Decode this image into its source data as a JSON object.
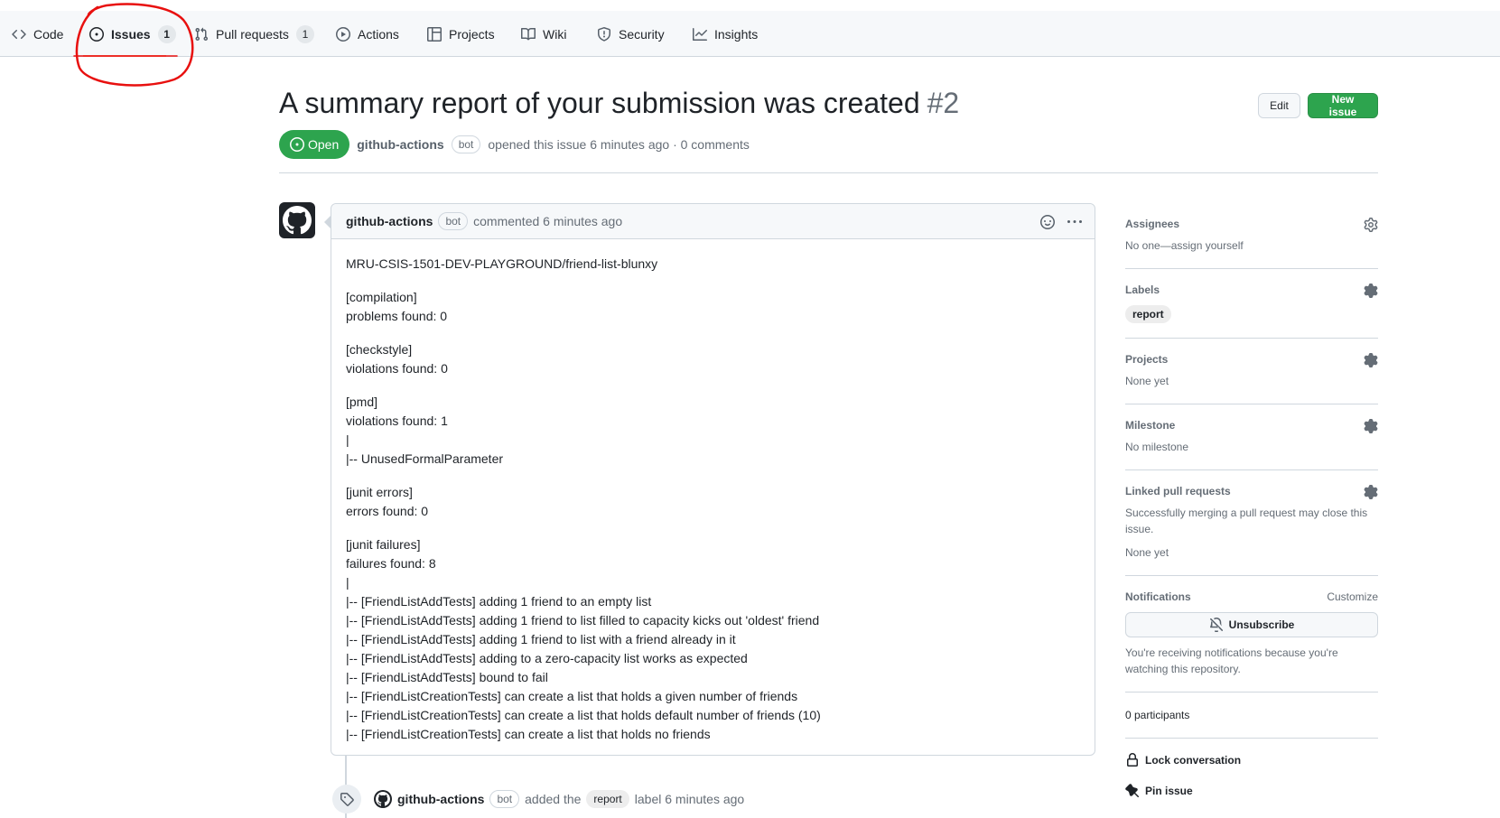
{
  "nav": {
    "items": [
      {
        "label": "Code",
        "icon": "code-icon"
      },
      {
        "label": "Issues",
        "icon": "issue-opened-icon",
        "counter": "1",
        "selected": true
      },
      {
        "label": "Pull requests",
        "icon": "git-pull-request-icon",
        "counter": "1"
      },
      {
        "label": "Actions",
        "icon": "play-icon"
      },
      {
        "label": "Projects",
        "icon": "table-icon"
      },
      {
        "label": "Wiki",
        "icon": "book-icon"
      },
      {
        "label": "Security",
        "icon": "shield-icon"
      },
      {
        "label": "Insights",
        "icon": "graph-icon"
      }
    ]
  },
  "annotation": {
    "color": "#e8100f"
  },
  "issue": {
    "title": "A summary report of your submission was created",
    "number": "#2",
    "state": "Open",
    "author": "github-actions",
    "author_badge": "bot",
    "meta": "opened this issue 6 minutes ago · 0 comments"
  },
  "buttons": {
    "edit": "Edit",
    "new_issue": "New issue"
  },
  "comment": {
    "author": "github-actions",
    "badge": "bot",
    "time": "commented 6 minutes ago",
    "paragraphs": [
      "MRU-CSIS-1501-DEV-PLAYGROUND/friend-list-blunxy",
      "[compilation]\nproblems found: 0",
      "[checkstyle]\nviolations found: 0",
      "[pmd]\nviolations found: 1\n|\n|-- UnusedFormalParameter",
      "[junit errors]\nerrors found: 0",
      "[junit failures]\nfailures found: 8\n|\n|-- [FriendListAddTests] adding 1 friend to an empty list\n|-- [FriendListAddTests] adding 1 friend to list filled to capacity kicks out 'oldest' friend\n|-- [FriendListAddTests] adding 1 friend to list with a friend already in it\n|-- [FriendListAddTests] adding to a zero-capacity list works as expected\n|-- [FriendListAddTests] bound to fail\n|-- [FriendListCreationTests] can create a list that holds a given number of friends\n|-- [FriendListCreationTests] can create a list that holds default number of friends (10)\n|-- [FriendListCreationTests] can create a list that holds no friends"
    ]
  },
  "event": {
    "author": "github-actions",
    "badge": "bot",
    "prefix": "added the",
    "label": "report",
    "suffix": "label 6 minutes ago"
  },
  "sidebar": {
    "assignees": {
      "title": "Assignees",
      "value": "No one—assign yourself"
    },
    "labels": {
      "title": "Labels",
      "value": "report"
    },
    "projects": {
      "title": "Projects",
      "value": "None yet"
    },
    "milestone": {
      "title": "Milestone",
      "value": "No milestone"
    },
    "linked": {
      "title": "Linked pull requests",
      "desc": "Successfully merging a pull request may close this issue.",
      "value": "None yet"
    },
    "notifications": {
      "title": "Notifications",
      "customize": "Customize",
      "button": "Unsubscribe",
      "desc": "You're receiving notifications because you're watching this repository."
    },
    "participants": "0 participants",
    "lock": "Lock conversation",
    "pin": "Pin issue"
  }
}
